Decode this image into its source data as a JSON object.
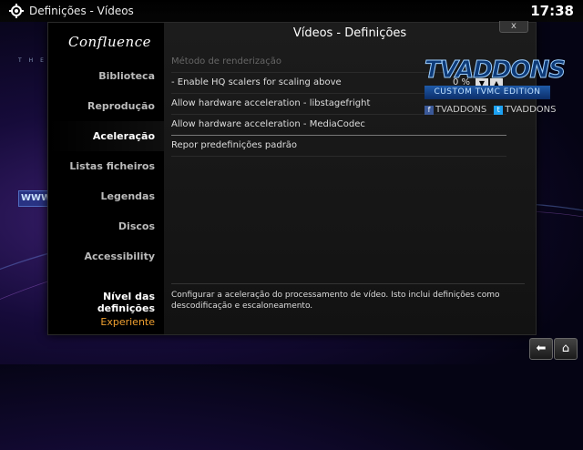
{
  "header": {
    "breadcrumb": "Definições  - Vídeos",
    "clock": "17:38"
  },
  "logo": {
    "text": "Confluence",
    "subtitle": "THE FUTURE OF T"
  },
  "sidebar": {
    "items": [
      {
        "label": "Biblioteca"
      },
      {
        "label": "Reprodução"
      },
      {
        "label": "Aceleração"
      },
      {
        "label": "Listas ficheiros"
      },
      {
        "label": "Legendas"
      },
      {
        "label": "Discos"
      },
      {
        "label": "Accessibility"
      }
    ],
    "settings_level_label": "Nível das definições",
    "settings_level_value": "Experiente"
  },
  "dialog": {
    "title": "Vídeos - Definições",
    "close_label": "x",
    "options": [
      {
        "label": "Método de renderização",
        "disabled": true
      },
      {
        "label": "- Enable HQ scalers for scaling above",
        "value": "0 %"
      },
      {
        "label": "Allow hardware acceleration - libstagefright"
      },
      {
        "label": "Allow hardware acceleration - MediaCodec"
      },
      {
        "label": "Repor predefinições padrão"
      }
    ],
    "description": "Configurar a aceleração do processamento de vídeo. Isto inclui definições como descodificação e escaloneamento."
  },
  "overlay": {
    "brand_text": "TVADDONS",
    "edition_text": "CUSTOM TVMC EDITION",
    "social_facebook": "TVADDONS",
    "social_twitter": "TVADDONS",
    "www_text": "WWW.TVADDONS"
  },
  "footer": {
    "back_icon": "back-arrow-icon",
    "home_icon": "home-icon"
  },
  "colors": {
    "accent": "#f0a030",
    "brand_blue": "#0d3a78"
  }
}
